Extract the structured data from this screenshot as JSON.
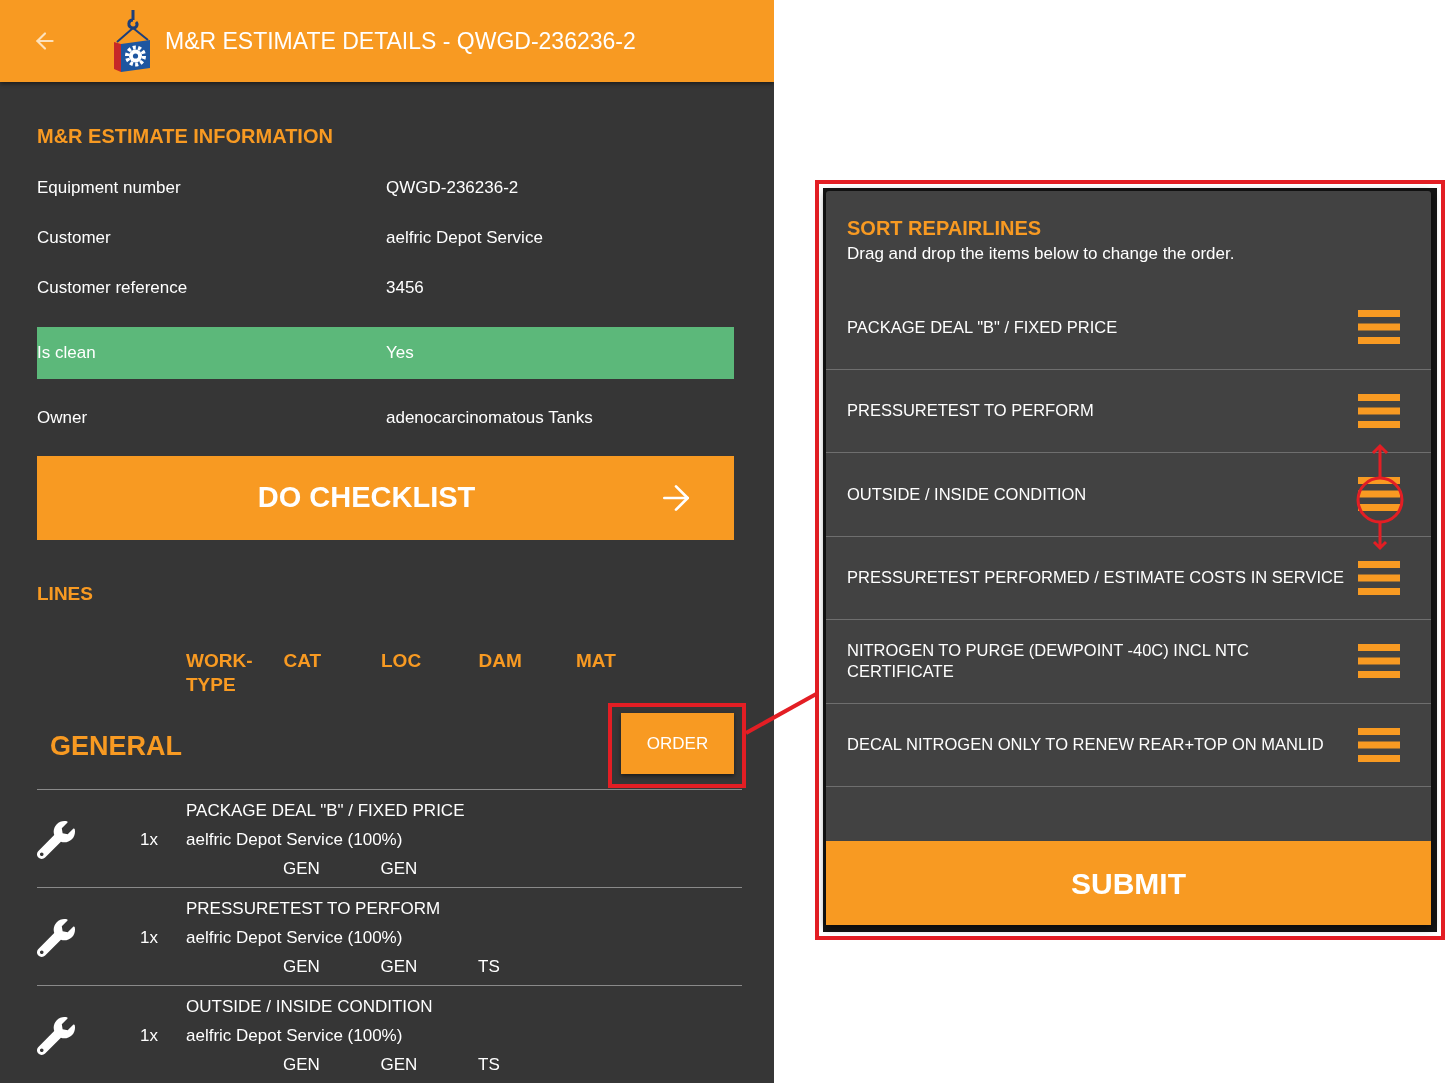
{
  "app_bar": {
    "title": "M&R ESTIMATE DETAILS - QWGD-236236-2"
  },
  "estimate_information": {
    "heading": "M&R ESTIMATE INFORMATION",
    "rows": [
      {
        "label": "Equipment number",
        "value": "QWGD-236236-2",
        "highlighted": false
      },
      {
        "label": "Customer",
        "value": "aelfric Depot Service",
        "highlighted": false
      },
      {
        "label": "Customer reference",
        "value": "3456",
        "highlighted": false
      },
      {
        "label": "Is clean",
        "value": "Yes",
        "highlighted": true
      },
      {
        "label": "Owner",
        "value": "adenocarcinomatous Tanks",
        "highlighted": false
      }
    ]
  },
  "checklist_button": {
    "label": "DO CHECKLIST"
  },
  "lines": {
    "heading": "LINES",
    "columns": [
      "WORK-TYPE",
      "CAT",
      "LOC",
      "DAM",
      "MAT"
    ],
    "group": {
      "title": "GENERAL",
      "order_button": {
        "label": "ORDER",
        "marked": true
      }
    },
    "items": [
      {
        "title": "PACKAGE DEAL \"B\" / FIXED PRICE",
        "quantity": "1x",
        "party": "aelfric Depot Service (100%)",
        "codes": [
          "GEN",
          "GEN"
        ]
      },
      {
        "title": "PRESSURETEST TO PERFORM",
        "quantity": "1x",
        "party": "aelfric Depot Service (100%)",
        "codes": [
          "GEN",
          "GEN",
          "TS"
        ]
      },
      {
        "title": "OUTSIDE / INSIDE CONDITION",
        "quantity": "1x",
        "party": "aelfric Depot Service (100%)",
        "codes": [
          "GEN",
          "GEN",
          "TS"
        ]
      }
    ]
  },
  "sort_dialog": {
    "title": "SORT REPAIRLINES",
    "instruction": "Drag and drop the items below to change the order.",
    "items": [
      {
        "label": "PACKAGE DEAL \"B\" / FIXED PRICE",
        "marked": false
      },
      {
        "label": "PRESSURETEST TO PERFORM",
        "marked": false
      },
      {
        "label": "OUTSIDE / INSIDE CONDITION",
        "marked": true
      },
      {
        "label": "PRESSURETEST PERFORMED / ESTIMATE COSTS IN SERVICE",
        "marked": false
      },
      {
        "label": "NITROGEN TO PURGE (DEWPOINT -40C) INCL NTC CERTIFICATE",
        "marked": false
      },
      {
        "label": "DECAL NITROGEN ONLY TO RENEW REAR+TOP ON MANLID",
        "marked": false
      }
    ],
    "submit_button": "SUBMIT"
  }
}
